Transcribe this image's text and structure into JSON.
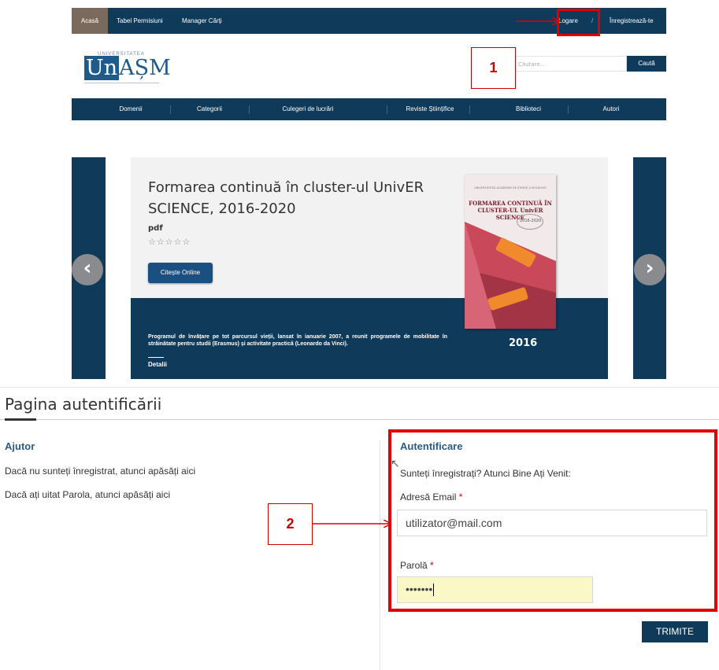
{
  "topbar": {
    "home": "Acasă",
    "permissions": "Tabel Permisiuni",
    "books": "Manager Cărți",
    "login": "Logare",
    "separator": "/",
    "register": "Înregistrează-te"
  },
  "logo": {
    "small": "UNIVERSITATEA",
    "mark": "Un",
    "rest": "AȘM"
  },
  "search": {
    "placeholder": "Căutare...",
    "button": "Caută"
  },
  "catnav": [
    "Domenii",
    "Categorii",
    "Culegeri de lucrări",
    "Reviste Științifice",
    "Biblioteci",
    "Autori"
  ],
  "slide": {
    "title": "Formarea continuă în cluster-ul UnivER SCIENCE, 2016-2020",
    "type": "pdf",
    "stars": "☆☆☆☆☆",
    "read_button": "Citește Online",
    "description": "Programul de învățare pe tot parcursul vieții, lansat în ianuarie 2007, a reunit programele de mobilitate în străinătate pentru studii (Erasmus) și activitate practică (Leonardo da Vinci).",
    "details": "Detalii",
    "year": "2016",
    "prev": "‹",
    "next": "›"
  },
  "cover": {
    "top": "UNIVERSITATEA ACADEMIEI DE ȘTIINȚE A MOLDOVEI",
    "title": "FORMAREA CONTINUĂ ÎN CLUSTER-UL UnivER SCIENCE",
    "years": "2016-2020"
  },
  "annotations": {
    "one": "1",
    "two": "2"
  },
  "login_page": {
    "title": "Pagina autentificării",
    "help_heading": "Ajutor",
    "help_register": "Dacă nu sunteți înregistrat, atunci apăsăți aici",
    "help_password": "Dacă ați uitat Parola, atunci apăsăți aici",
    "auth_heading": "Autentificare",
    "welcome": "Sunteți înregistrați? Atunci Bine Ați Venit:",
    "email_label": "Adresă Email",
    "email_value": "utilizator@mail.com",
    "password_label": "Parolă",
    "password_value": "•••••••",
    "required": "*",
    "submit": "TRIMITE"
  },
  "colors": {
    "navy": "#0f3a5a",
    "accent_red": "#e00000",
    "link_blue": "#2b5b85"
  }
}
